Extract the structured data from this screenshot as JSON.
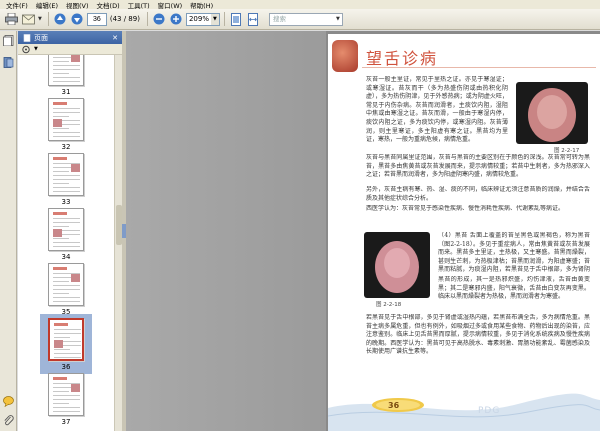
{
  "menu": [
    "文件(F)",
    "编辑(E)",
    "视图(V)",
    "文档(D)",
    "工具(T)",
    "窗口(W)",
    "帮助(H)"
  ],
  "toolbar": {
    "page_number": "36",
    "page_count": "(43 / 89)",
    "zoom": "209%",
    "search_placeholder": "搜索"
  },
  "panel": {
    "title": "页面",
    "thumbnails": [
      {
        "label": "31",
        "selected": false
      },
      {
        "label": "32",
        "selected": false
      },
      {
        "label": "33",
        "selected": false
      },
      {
        "label": "34",
        "selected": false
      },
      {
        "label": "35",
        "selected": false
      },
      {
        "label": "36",
        "selected": true
      },
      {
        "label": "37",
        "selected": false
      }
    ]
  },
  "page": {
    "title": "望舌诊病",
    "para1": "灰苔一般主里证，常见于里热之证。亦见于寒湿证；或寒湿证。苔灰而干（多为热盛伤阴或由热积化阴虚），多为热伤阴津，见于外感热病；或为阴虚火旺，常见于内伤杂病。灰苔而润滑者，主痰饮内阻，湿阻中焦或由寒湿之证。苔灰而滑，一般由于寒湿内停，痰饮内阻之证，多为痰饮内停，或寒湿内阻。灰苔薄润，则主里寒证，多主阳虚有寒之证。黑苔均为里证，寒热，一般为重病危候，病情危重。",
    "para2": "灰苔与黑苔同属里证范围，灰苔与黑苔的主要区别在于颜色的深浅。灰苔常可转为黑苔，黑苔多由焦黄苔或灰苔发展而来，提示病情较重；若苔中生刺者，多为热邪深入之证；若苔黑而润滑者，多为阳虚阴寒内盛，病情较危重。",
    "para3": "另外，灰苔主病有寒、热、湿、痰的不同，临床辨证尤须注意苔质的润燥，并结合舌质及其他症状综合分析。",
    "para4": "西医学认为：灰苔常见于感染性疾病、慢性消耗性疾病、代谢紊乱等病证。",
    "para5": "（4）黑苔 舌面上覆盖的苔呈黑色或黑褐色，称为黑苔（图2-2-18）。多见于重症病人，常由焦黄苔或灰苔发展而来。黑苔多主里证，主热极，又主寒盛。苔黑而燥裂，甚则生芒刺，为热极津枯；苔黑而润滑，为阳虚寒盛；苔黑而粘腻，为痰湿内阻，若黑苔见于舌中根部，多为肾阴不足。",
    "para6": "黑苔的形成，其一是热邪炽盛，灼伤津液，舌苔由黄变黑；其二是寒邪内盛，阳气衰微，舌苔由白变灰再变黑。临床以黑而燥裂者为热极，黑而润滑者为寒盛。",
    "para7": "若黑苔见于舌中根部，多见于肾虚或湿热内蕴，若黑苔布满全舌，多为病情危重。黑苔主病多属危重，但也有例外，如吸烟过多或食用某些食物、药物后出现的染苔，应注意鉴别。临床上见舌苔黑而厚腻，提示病情较重，多见于消化系统疾病及慢性疾病的晚期。西医学认为：黑苔可见于高热脱水、毒素刺激、胃肠功能紊乱、霉菌感染及长期使用广谱抗生素等。",
    "caption1": "图 2-2-17",
    "caption2": "图 2-2-18",
    "page_no": "36",
    "watermark": "PDG"
  }
}
